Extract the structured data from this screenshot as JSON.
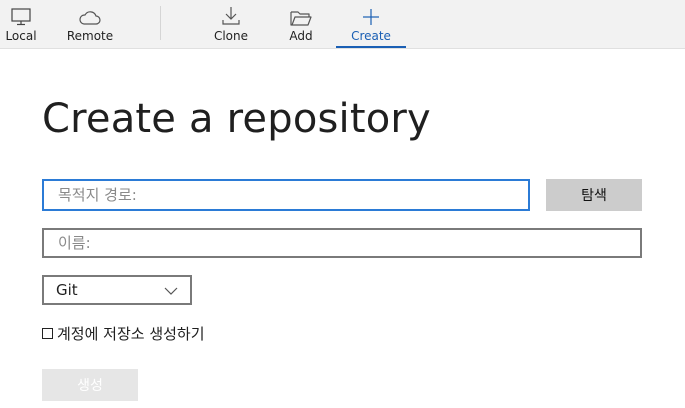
{
  "toolbar": {
    "items": [
      {
        "label": "Local",
        "icon": "monitor-icon"
      },
      {
        "label": "Remote",
        "icon": "cloud-icon"
      },
      {
        "label": "Clone",
        "icon": "download-icon"
      },
      {
        "label": "Add",
        "icon": "folder-icon"
      },
      {
        "label": "Create",
        "icon": "plus-icon"
      }
    ],
    "active": "Create",
    "accent": "#1a5fb4"
  },
  "page": {
    "title": "Create a repository",
    "path_placeholder": "목적지 경로:",
    "path_value": "",
    "browse_label": "탐색",
    "name_placeholder": "이름:",
    "name_value": "",
    "vcs_selected": "Git",
    "create_on_account_label": "계정에 저장소 생성하기",
    "create_on_account_checked": false,
    "create_button_label": "생성"
  }
}
